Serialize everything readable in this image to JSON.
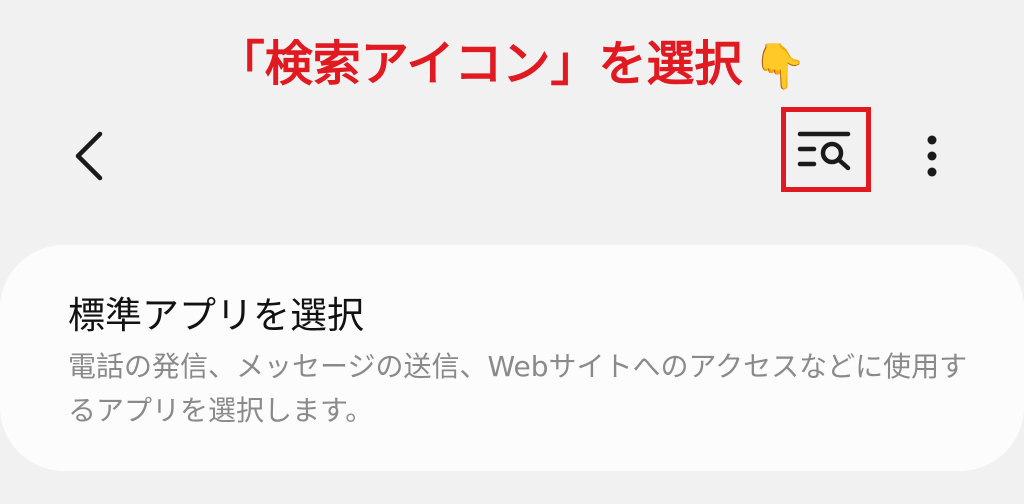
{
  "annotation": {
    "text": "「検索アイコン」を選択",
    "pointer_emoji": "👇",
    "color": "#e11a22"
  },
  "header": {
    "back_icon": "chevron-left-icon",
    "search_icon": "list-search-icon",
    "more_icon": "more-vertical-icon"
  },
  "card": {
    "title": "標準アプリを選択",
    "description": "電話の発信、メッセージの送信、Webサイトへのアクセスなどに使用するアプリを選択します。"
  },
  "colors": {
    "background": "#f2f1f1",
    "card": "#fcfcfc",
    "highlight": "#e11a22",
    "title_text": "#121212",
    "description_text": "#8a8a8a"
  }
}
